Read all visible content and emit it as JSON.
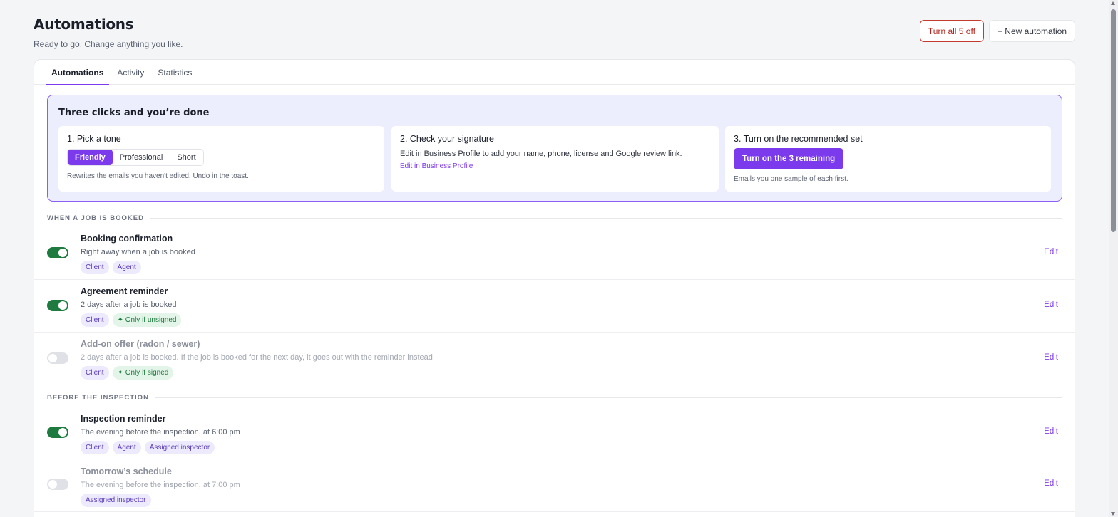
{
  "page": {
    "title": "Automations",
    "subtitle": "Ready to go. Change anything you like.",
    "turn_all_off_label": "Turn all 5 off",
    "new_automation_label": "+ New automation"
  },
  "tabs": [
    {
      "label": "Automations",
      "active": true
    },
    {
      "label": "Activity",
      "active": false
    },
    {
      "label": "Statistics",
      "active": false
    }
  ],
  "onboarding": {
    "title": "Three clicks and you’re done",
    "step1": {
      "title": "1. Pick a tone",
      "options": [
        "Friendly",
        "Professional",
        "Short"
      ],
      "selected": "Friendly",
      "note": "Rewrites the emails you haven't edited. Undo in the toast."
    },
    "step2": {
      "title": "2. Check your signature",
      "text": "Edit in Business Profile to add your name, phone, license and Google review link.",
      "link": "Edit in Business Profile"
    },
    "step3": {
      "title": "3. Turn on the recommended set",
      "button": "Turn on the 3 remaining",
      "note": "Emails you one sample of each first."
    }
  },
  "sections": [
    {
      "title": "WHEN A JOB IS BOOKED",
      "rows": [
        {
          "title": "Booking confirmation",
          "desc": "Right away when a job is booked",
          "enabled": true,
          "tags": [
            "Client",
            "Agent"
          ],
          "condition": "",
          "edit": "Edit"
        },
        {
          "title": "Agreement reminder",
          "desc": "2 days after a job is booked",
          "enabled": true,
          "tags": [
            "Client"
          ],
          "condition": "✦ Only if unsigned",
          "edit": "Edit"
        },
        {
          "title": "Add-on offer (radon / sewer)",
          "desc": "2 days after a job is booked. If the job is booked for the next day, it goes out with the reminder instead",
          "enabled": false,
          "tags": [
            "Client"
          ],
          "condition": "✦ Only if signed",
          "edit": "Edit"
        }
      ]
    },
    {
      "title": "BEFORE THE INSPECTION",
      "rows": [
        {
          "title": "Inspection reminder",
          "desc": "The evening before the inspection, at 6:00 pm",
          "enabled": true,
          "tags": [
            "Client",
            "Agent",
            "Assigned inspector"
          ],
          "condition": "",
          "edit": "Edit"
        },
        {
          "title": "Tomorrow’s schedule",
          "desc": "The evening before the inspection, at 7:00 pm",
          "enabled": false,
          "tags": [
            "Assigned inspector"
          ],
          "condition": "",
          "edit": "Edit"
        }
      ]
    }
  ],
  "colors": {
    "accent": "#7c3aed",
    "toggle_on": "#1e7a3e",
    "danger": "#b3261e"
  }
}
